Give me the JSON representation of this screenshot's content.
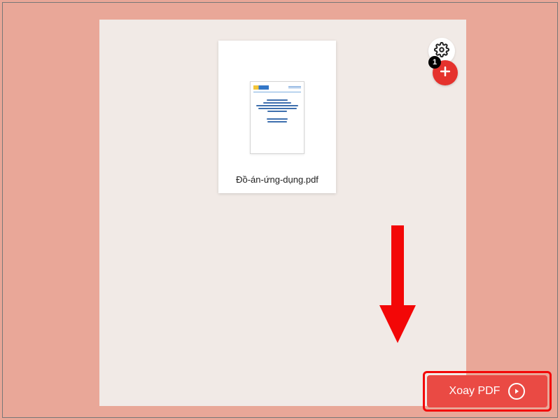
{
  "settings_icon_name": "gear-icon",
  "add_icon_name": "plus-icon",
  "badge_count": "1",
  "file": {
    "name": "Đồ-án-ứng-dụng.pdf"
  },
  "primary_button": {
    "label": "Xoay PDF"
  },
  "colors": {
    "accent_red": "#ea4a44",
    "highlight_red": "#f30707",
    "bg_pink": "#e9a798",
    "panel_bg": "#f1eae6"
  }
}
